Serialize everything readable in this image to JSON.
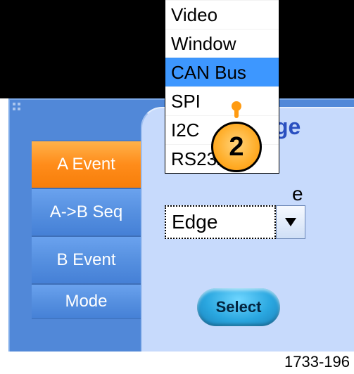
{
  "tabs": {
    "a_event": "A Event",
    "ab_seq": "A->B Seq",
    "b_event": "B Event",
    "mode": "Mode"
  },
  "panel": {
    "title_fragment": "ge",
    "subtitle_fragment": "e"
  },
  "dropdown": {
    "options": [
      "Video",
      "Window",
      "CAN Bus",
      "SPI",
      "I2C",
      "RS232"
    ],
    "highlighted": "CAN Bus",
    "selected": "Edge"
  },
  "select_button": "Select",
  "callout_number": "2",
  "doc_number": "1733-196"
}
